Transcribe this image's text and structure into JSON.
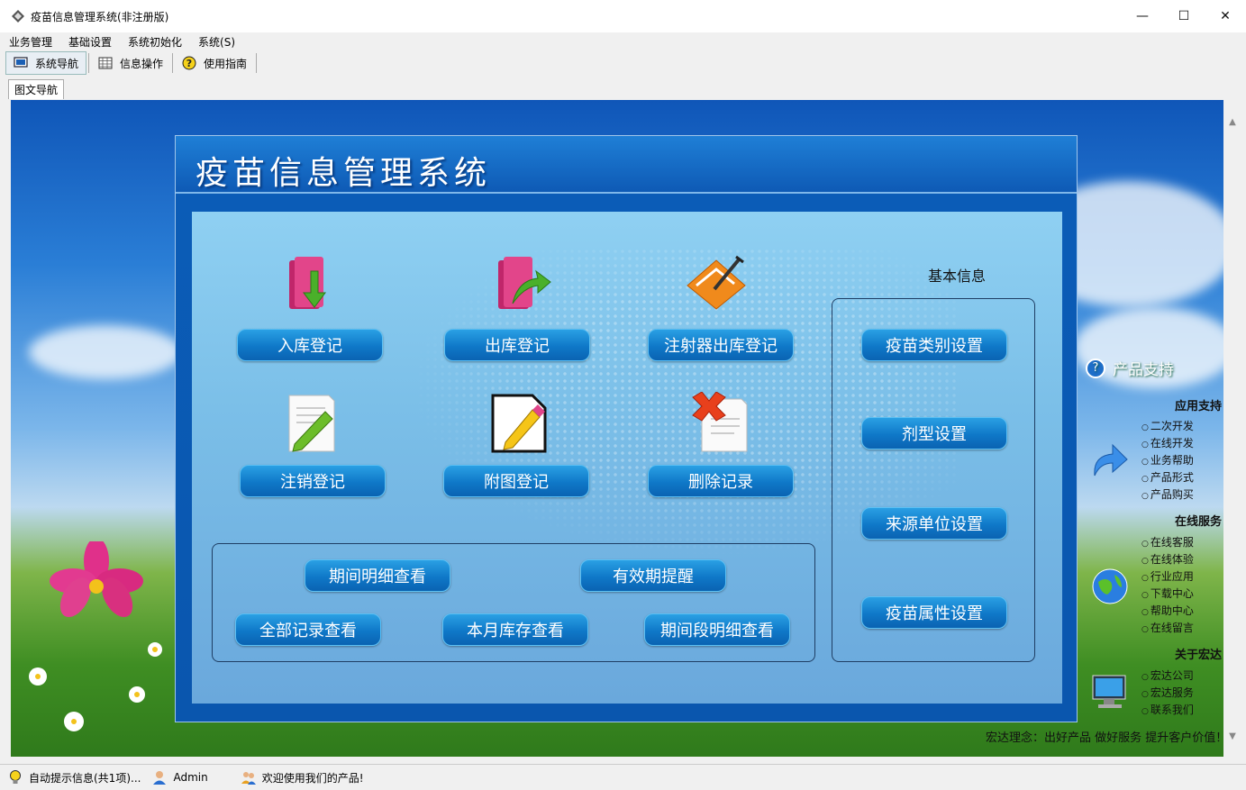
{
  "window": {
    "title": "疫苗信息管理系统(非注册版)",
    "minimize": "—",
    "maximize": "☐",
    "close": "✕"
  },
  "menu": [
    "业务管理",
    "基础设置",
    "系统初始化",
    "系统(S)"
  ],
  "toolbar": {
    "nav": "系统导航",
    "info": "信息操作",
    "guide": "使用指南"
  },
  "tab": "图文导航",
  "panel": {
    "title": "疫苗信息管理系统",
    "main_buttons": [
      "入库登记",
      "出库登记",
      "注射器出库登记",
      "注销登记",
      "附图登记",
      "删除记录"
    ],
    "query_buttons": [
      "期间明细查看",
      "有效期提醒",
      "全部记录查看",
      "本月库存查看",
      "期间段明细查看"
    ],
    "basic_title": "基本信息",
    "basic_buttons": [
      "疫苗类别设置",
      "剂型设置",
      "来源单位设置",
      "疫苗属性设置"
    ]
  },
  "side": {
    "title": "产品支持",
    "sections": [
      {
        "title": "应用支持",
        "items": [
          "二次开发",
          "在线开发",
          "业务帮助",
          "产品形式",
          "产品购买"
        ]
      },
      {
        "title": "在线服务",
        "items": [
          "在线客服",
          "在线体验",
          "行业应用",
          "下载中心",
          "帮助中心",
          "在线留言"
        ]
      },
      {
        "title": "关于宏达",
        "items": [
          "宏达公司",
          "宏达服务",
          "联系我们"
        ]
      }
    ]
  },
  "ticker": "宏达理念：出好产品 做好服务 提升客户价值！",
  "status": {
    "hint": "自动提示信息(共1项)...",
    "user": "Admin",
    "welcome": "欢迎使用我们的产品!"
  }
}
